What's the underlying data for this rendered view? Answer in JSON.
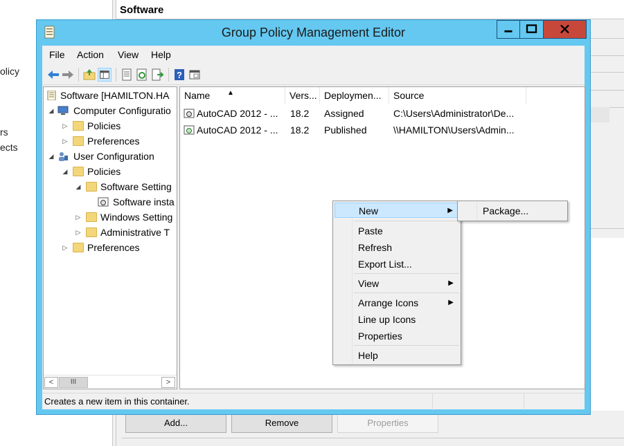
{
  "background": {
    "left_panel_lines": [
      "olicy",
      "rs",
      "ects"
    ],
    "header_title": "Software",
    "buttons": {
      "add": "Add...",
      "remove": "Remove",
      "properties": "Properties"
    }
  },
  "window": {
    "title": "Group Policy Management Editor",
    "icon": "gpo-editor-icon",
    "controls": {
      "minimize": "minimize-icon",
      "maximize": "maximize-icon",
      "close": "close-icon"
    },
    "colors": {
      "titlebar": "#64c8f0",
      "close": "#c7483b",
      "selection": "#cce8ff"
    }
  },
  "menubar": [
    "File",
    "Action",
    "View",
    "Help"
  ],
  "toolbar": [
    "back-icon",
    "forward-icon",
    "up-folder-icon",
    "show-tree-icon",
    "properties-icon",
    "refresh-icon",
    "export-list-icon",
    "help-icon",
    "show-hide-icon"
  ],
  "tree": {
    "root": "Software [HAMILTON.HA",
    "computer_config": "Computer Configuratio",
    "cc_policies": "Policies",
    "cc_preferences": "Preferences",
    "user_config": "User Configuration",
    "uc_policies": "Policies",
    "software_settings": "Software Setting",
    "software_install": "Software insta",
    "windows_settings": "Windows Setting",
    "admin_templates": "Administrative T",
    "uc_preferences": "Preferences",
    "scroll_thumb": "III"
  },
  "list": {
    "columns": [
      "Name",
      "Vers...",
      "Deploymen...",
      "Source"
    ],
    "rows": [
      {
        "name": "AutoCAD 2012 - ...",
        "version": "18.2",
        "deployment": "Assigned",
        "source": "C:\\Users\\Administrator\\De..."
      },
      {
        "name": "AutoCAD 2012 - ...",
        "version": "18.2",
        "deployment": "Published",
        "source": "\\\\HAMILTON\\Users\\Admin..."
      }
    ]
  },
  "context_menu": {
    "items": [
      "New",
      "Paste",
      "Refresh",
      "Export List...",
      "View",
      "Arrange Icons",
      "Line up Icons",
      "Properties",
      "Help"
    ],
    "submenu": [
      "Package..."
    ]
  },
  "status": "Creates a new item in this container."
}
